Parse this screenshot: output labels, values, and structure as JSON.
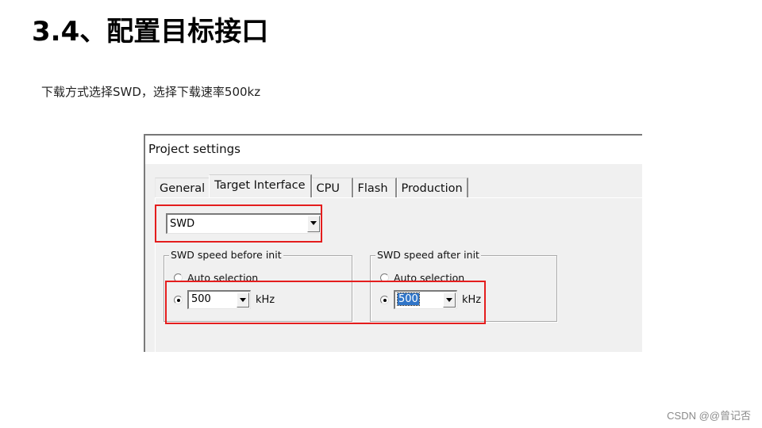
{
  "slide": {
    "title": "3.4、配置目标接口",
    "description": "下载方式选择SWD，选择下载速率500kz",
    "watermark": "CSDN @@曾记否"
  },
  "dialog": {
    "title": "Project settings",
    "tabs": [
      {
        "label": "General",
        "active": false
      },
      {
        "label": "Target Interface",
        "active": true
      },
      {
        "label": "CPU",
        "active": false
      },
      {
        "label": "Flash",
        "active": false
      },
      {
        "label": "Production",
        "active": false
      }
    ],
    "interface_select": {
      "value": "SWD"
    },
    "speed_before_init": {
      "legend": "SWD speed before init",
      "auto_label": "Auto selection",
      "auto_checked": false,
      "manual_checked": true,
      "speed_value": "500",
      "unit": "kHz"
    },
    "speed_after_init": {
      "legend": "SWD speed after init",
      "auto_label": "Auto selection",
      "auto_checked": false,
      "manual_checked": true,
      "speed_value": "500",
      "unit": "kHz"
    },
    "highlight_color": "#e41d1d"
  }
}
